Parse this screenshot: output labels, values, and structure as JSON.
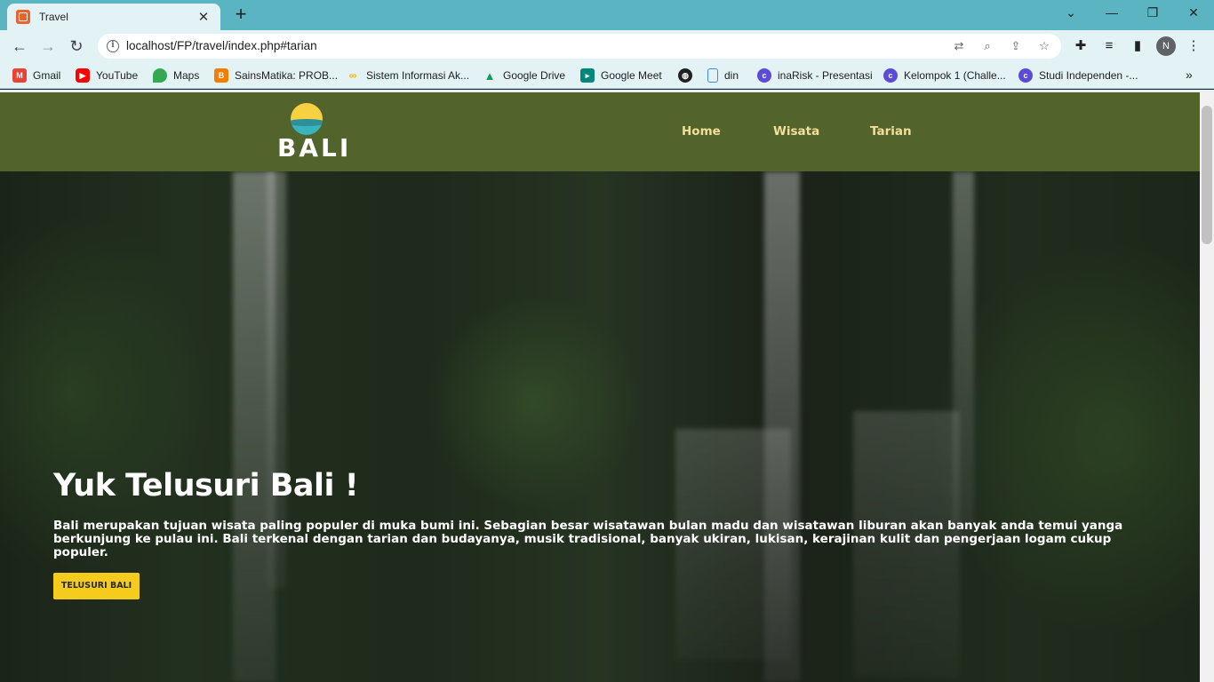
{
  "browser": {
    "tab": {
      "title": "Travel",
      "close": "✕"
    },
    "new_tab": "+",
    "window": {
      "minimize": "—",
      "restore": "❐",
      "close": "✕",
      "tabsearch": "⌄"
    },
    "address": {
      "url": "localhost/FP/travel/index.php#tarian"
    },
    "profile_initial": "N",
    "bookmarks": [
      {
        "label": "Gmail",
        "icon": "gmail-icon",
        "color": "#ea4335"
      },
      {
        "label": "YouTube",
        "icon": "youtube-icon",
        "color": "#ff0000"
      },
      {
        "label": "Maps",
        "icon": "maps-icon",
        "color": "#34a853"
      },
      {
        "label": "SainsMatika: PROB...",
        "icon": "blogger-icon",
        "color": "#f57d00"
      },
      {
        "label": "Sistem Informasi Ak...",
        "icon": "link-icon",
        "color": "#f4b400"
      },
      {
        "label": "Google Drive",
        "icon": "drive-icon",
        "color": "#0f9d58"
      },
      {
        "label": "Google Meet",
        "icon": "meet-icon",
        "color": "#00897b"
      },
      {
        "label": "",
        "icon": "globe-icon",
        "color": "#202124"
      },
      {
        "label": "din",
        "icon": "document-icon",
        "color": "#4285f4"
      },
      {
        "label": "inaRisk - Presentasi",
        "icon": "canva-icon",
        "color": "#5b4bd8"
      },
      {
        "label": "Kelompok 1 (Challe...",
        "icon": "canva-icon",
        "color": "#5b4bd8"
      },
      {
        "label": "Studi Independen -...",
        "icon": "canva-icon",
        "color": "#5b4bd8"
      }
    ],
    "bookmarks_more": "»"
  },
  "site": {
    "logo_text": "BALI",
    "nav": [
      {
        "label": "Home"
      },
      {
        "label": "Wisata"
      },
      {
        "label": "Tarian"
      }
    ],
    "hero": {
      "title": "Yuk Telusuri Bali !",
      "text": "Bali merupakan tujuan wisata paling populer di muka bumi ini. Sebagian besar wisatawan bulan madu dan wisatawan liburan akan banyak anda temui yanga berkunjung ke pulau ini. Bali terkenal dengan tarian dan budayanya, musik tradisional, banyak ukiran, lukisan, kerajinan kulit dan pengerjaan logam cukup populer.",
      "button": "TELUSURI BALI"
    },
    "colors": {
      "header": "#53632c",
      "button": "#f5cc1e",
      "nav": "#f3df9a"
    }
  }
}
